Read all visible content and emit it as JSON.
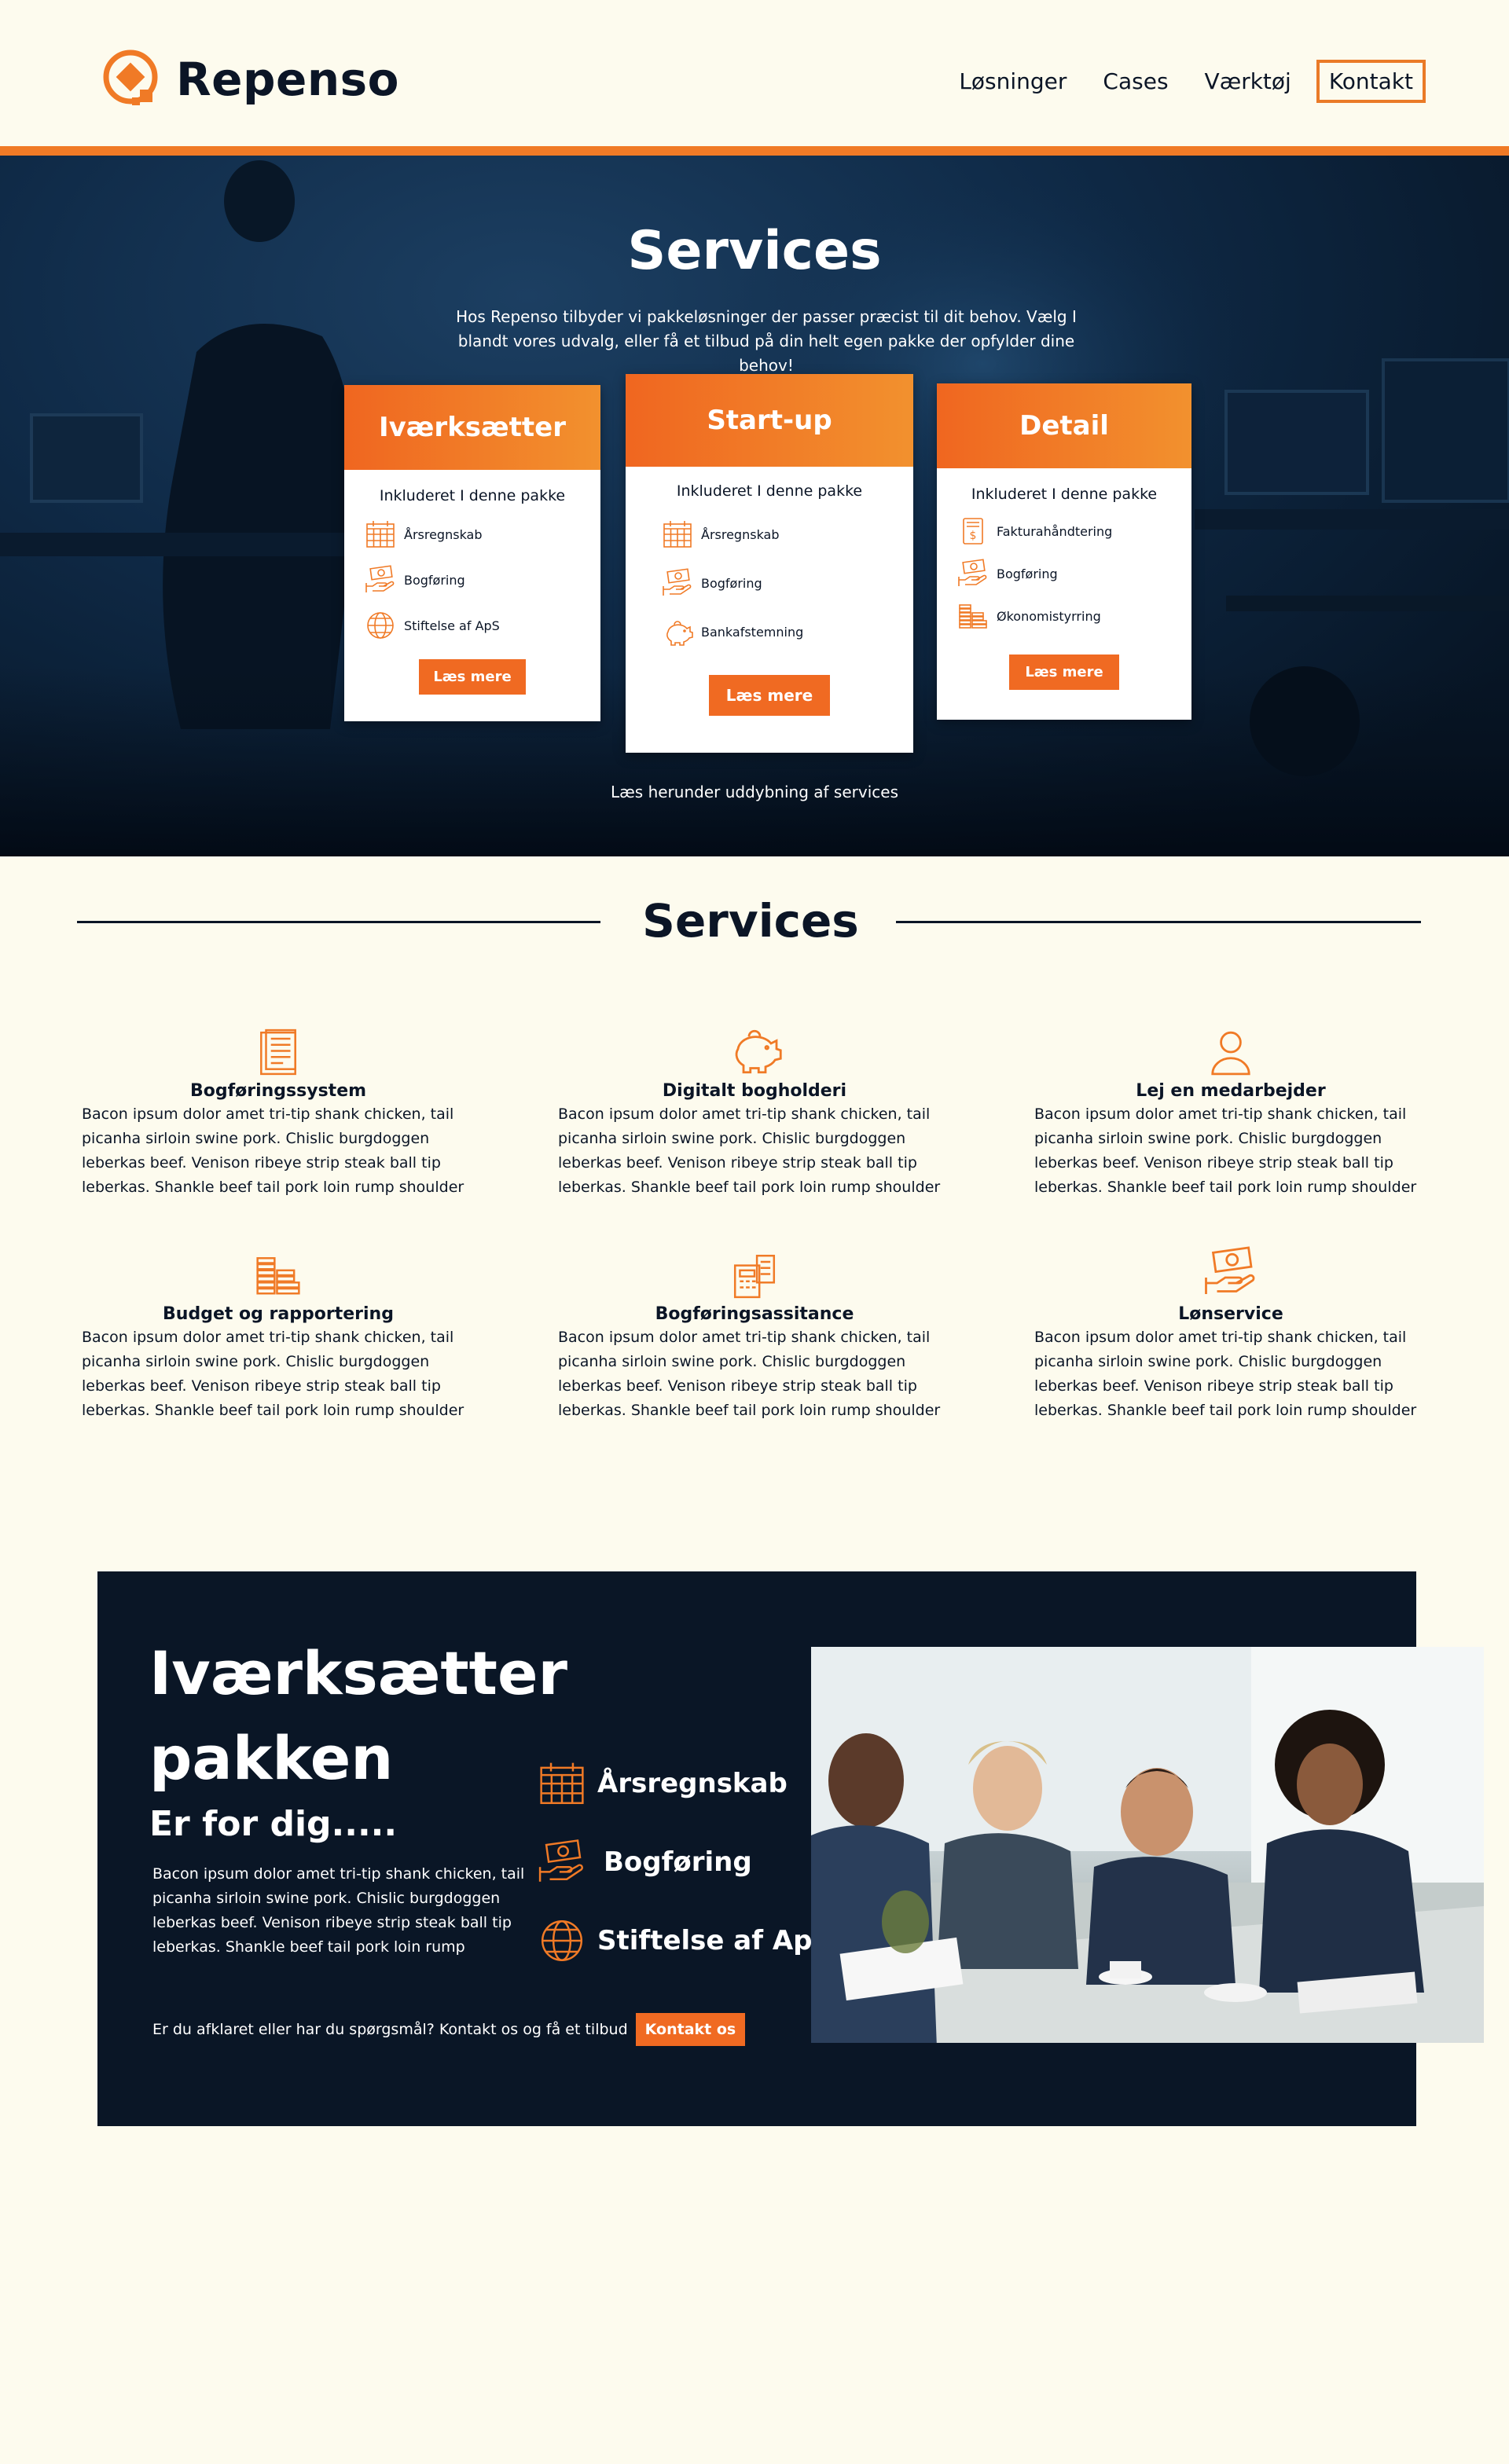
{
  "header": {
    "logo_text": "Repenso",
    "nav": [
      "Løsninger",
      "Cases",
      "Værktøj"
    ],
    "contact_label": "Kontakt"
  },
  "colors": {
    "accent": "#f07a26",
    "navy": "#0a1626",
    "cream": "#fdfbee"
  },
  "hero": {
    "title": "Services",
    "subtitle": "Hos Repenso tilbyder vi pakkeløsninger der passer præcist til dit behov. Vælg I blandt vores udvalg, eller få et tilbud på din helt egen pakke der opfylder dine behov!",
    "footer": "Læs herunder uddybning af services",
    "cards": [
      {
        "title": "Iværksætter",
        "included": "Inkluderet I denne pakke",
        "items": [
          {
            "icon": "calendar-icon",
            "label": "Årsregnskab"
          },
          {
            "icon": "money-hand-icon",
            "label": "Bogføring"
          },
          {
            "icon": "globe-icon",
            "label": "Stiftelse af ApS"
          }
        ],
        "button": "Læs mere"
      },
      {
        "title": "Start-up",
        "included": "Inkluderet I denne pakke",
        "items": [
          {
            "icon": "calendar-icon",
            "label": "Årsregnskab"
          },
          {
            "icon": "money-hand-icon",
            "label": "Bogføring"
          },
          {
            "icon": "piggy-bank-icon",
            "label": "Bankafstemning"
          }
        ],
        "button": "Læs mere"
      },
      {
        "title": "Detail",
        "included": "Inkluderet I denne pakke",
        "items": [
          {
            "icon": "invoice-icon",
            "label": "Fakturahåndtering"
          },
          {
            "icon": "money-hand-icon",
            "label": "Bogføring"
          },
          {
            "icon": "coins-stack-icon",
            "label": "Økonomistyrring"
          }
        ],
        "button": "Læs mere"
      }
    ]
  },
  "services": {
    "title": "Services",
    "items": [
      {
        "icon": "ledger-icon",
        "name": "Bogføringssystem",
        "text": "Bacon ipsum dolor amet tri-tip shank chicken, tail picanha sirloin swine pork. Chislic burgdoggen leberkas beef. Venison ribeye strip steak ball tip leberkas. Shankle beef tail pork loin rump shoulder"
      },
      {
        "icon": "piggy-bank-icon",
        "name": "Digitalt bogholderi",
        "text": "Bacon ipsum dolor amet tri-tip shank chicken, tail picanha sirloin swine pork. Chislic burgdoggen leberkas beef. Venison ribeye strip steak ball tip leberkas. Shankle beef tail pork loin rump shoulder"
      },
      {
        "icon": "person-icon",
        "name": "Lej en medarbejder",
        "text": "Bacon ipsum dolor amet tri-tip shank chicken, tail picanha sirloin swine pork. Chislic burgdoggen leberkas beef. Venison ribeye strip steak ball tip leberkas. Shankle beef tail pork loin rump shoulder"
      },
      {
        "icon": "coins-stack-icon",
        "name": "Budget og rapportering",
        "text": "Bacon ipsum dolor amet tri-tip shank chicken, tail picanha sirloin swine pork. Chislic burgdoggen leberkas beef. Venison ribeye strip steak ball tip leberkas. Shankle beef tail pork loin rump shoulder"
      },
      {
        "icon": "calculator-icon",
        "name": "Bogføringsassitance",
        "text": "Bacon ipsum dolor amet tri-tip shank chicken, tail picanha sirloin swine pork. Chislic burgdoggen leberkas beef. Venison ribeye strip steak ball tip leberkas. Shankle beef tail pork loin rump shoulder"
      },
      {
        "icon": "money-hand-icon",
        "name": "Lønservice",
        "text": "Bacon ipsum dolor amet tri-tip shank chicken, tail picanha sirloin swine pork. Chislic burgdoggen leberkas beef. Venison ribeye strip steak ball tip leberkas. Shankle beef tail pork loin rump shoulder"
      }
    ]
  },
  "promo": {
    "title_line1": "Iværksætter",
    "title_line2": "pakken",
    "subtitle": "Er for dig.....",
    "text": "Bacon ipsum dolor amet tri-tip shank chicken, tail picanha sirloin swine pork. Chislic burgdoggen leberkas beef. Venison ribeye strip steak ball tip leberkas. Shankle beef tail pork loin rump",
    "items": [
      {
        "icon": "calendar-icon",
        "label": "Årsregnskab"
      },
      {
        "icon": "money-hand-icon",
        "label": "Bogføring"
      },
      {
        "icon": "globe-icon",
        "label": "Stiftelse af ApS"
      }
    ],
    "cta_text": "Er du afklaret eller har du spørgsmål? Kontakt os og få et tilbud",
    "cta_button": "Kontakt os"
  }
}
